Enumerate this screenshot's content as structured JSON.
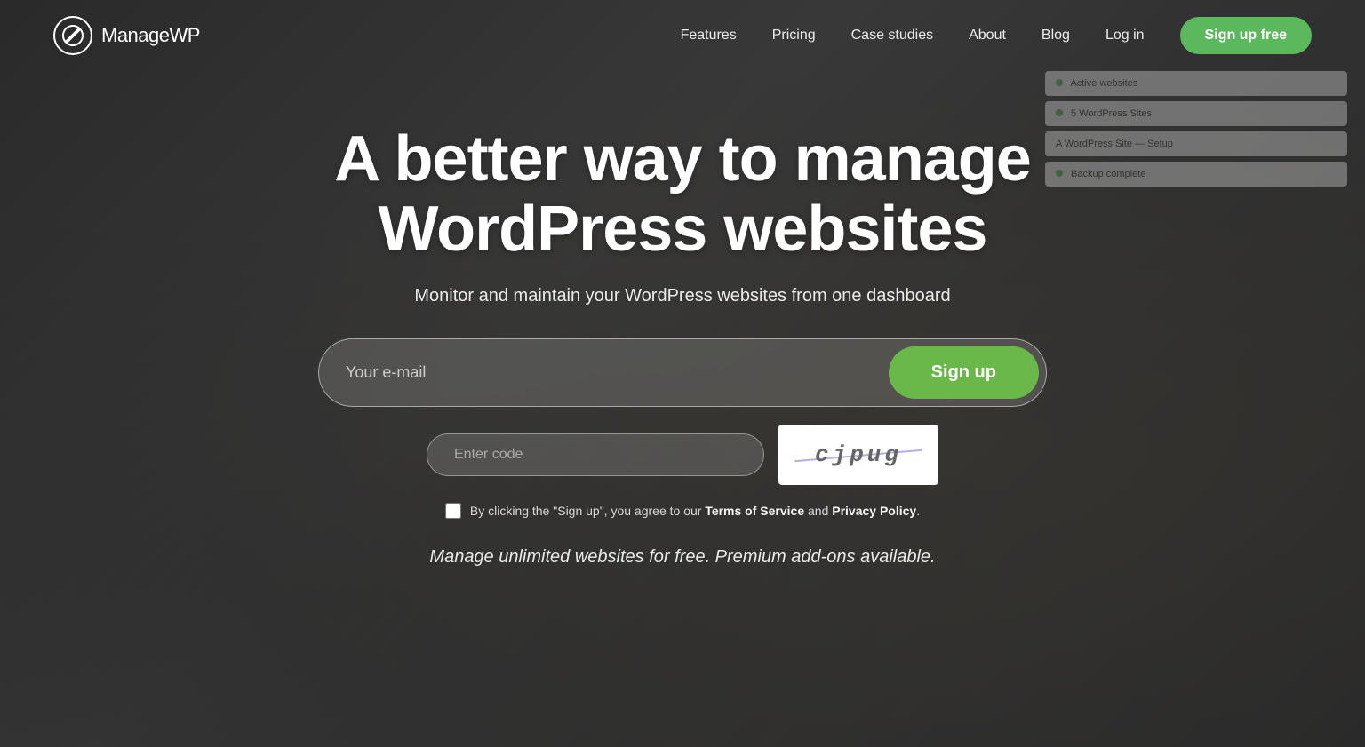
{
  "brand": {
    "name_part1": "Manage",
    "name_part2": "WP",
    "logo_aria": "ManageWP logo"
  },
  "nav": {
    "links": [
      {
        "label": "Features",
        "id": "features"
      },
      {
        "label": "Pricing",
        "id": "pricing"
      },
      {
        "label": "Case studies",
        "id": "case-studies"
      },
      {
        "label": "About",
        "id": "about"
      },
      {
        "label": "Blog",
        "id": "blog"
      },
      {
        "label": "Log in",
        "id": "login"
      }
    ],
    "cta_label": "Sign up free"
  },
  "hero": {
    "title": "A better way to manage WordPress websites",
    "subtitle": "Monitor and maintain your WordPress websites from one dashboard",
    "email_placeholder": "Your e-mail",
    "signup_btn_label": "Sign up",
    "captcha_placeholder": "Enter code",
    "captcha_text": "cjpug",
    "terms_text_before": "By clicking the \"Sign up\", you agree to our ",
    "terms_link1": "Terms of Service",
    "terms_text_mid": " and ",
    "terms_link2": "Privacy Policy",
    "terms_text_after": ".",
    "tagline": "Manage unlimited websites for free. Premium add-ons available."
  },
  "colors": {
    "green_primary": "#5cb85c",
    "green_signup": "#6bb84a",
    "white": "#ffffff",
    "overlay_dark": "rgba(30,30,30,0.55)"
  }
}
